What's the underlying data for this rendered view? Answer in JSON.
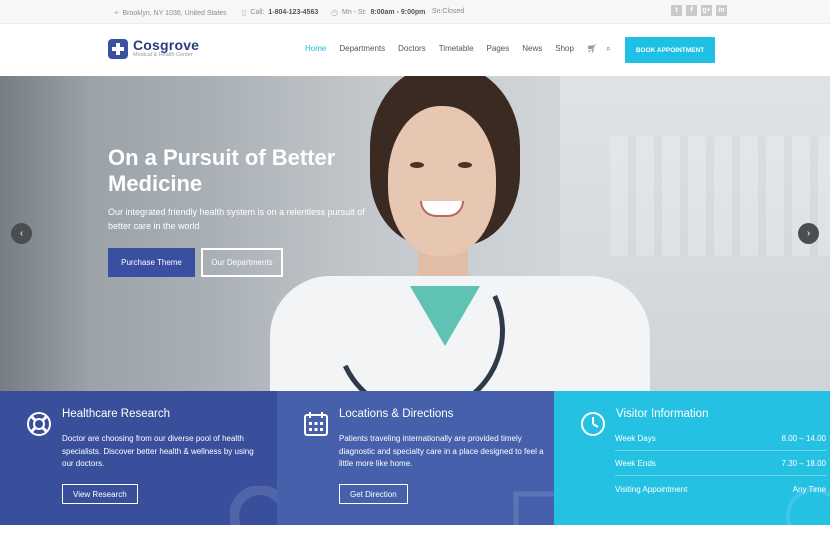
{
  "topbar": {
    "address": "Brooklyn, NY 1036, United States",
    "call_label": "Call:",
    "call_number": "1-804-123-4563",
    "hours_label": "Mn - St:",
    "hours": "8:00am - 9:00pm",
    "sunday": "Sn:Closed",
    "social": [
      "twitter-icon",
      "facebook-icon",
      "google-plus-icon",
      "linkedin-icon"
    ]
  },
  "header": {
    "logo_name": "Cosgrove",
    "logo_tagline": "Medical & Health Center",
    "nav": [
      "Home",
      "Departments",
      "Doctors",
      "Timetable",
      "Pages",
      "News",
      "Shop"
    ],
    "book_button": "BOOK APPOINTMENT"
  },
  "hero": {
    "title": "On a Pursuit of Better Medicine",
    "subtitle": "Our integrated friendly health system is on a relentless pursuit of better care in the world",
    "primary_button": "Purchase Theme",
    "secondary_button": "Our Departments"
  },
  "panels": {
    "research": {
      "title": "Healthcare Research",
      "text": "Doctor are choosing from our diverse pool of health specialists. Discover better health & wellness by using our doctors.",
      "button": "View Research"
    },
    "locations": {
      "title": "Locations & Directions",
      "text": "Patients traveling internationally are provided timely diagnostic and specialty care in a place designed to feel a little more like home.",
      "button": "Get Direction"
    },
    "visitor": {
      "title": "Visitor Information",
      "rows": [
        {
          "label": "Week Days",
          "value": "8.00 – 14.00"
        },
        {
          "label": "Week Ends",
          "value": "7.30 – 18.00"
        },
        {
          "label": "Visiting Appointment",
          "value": "Any Time"
        }
      ]
    }
  },
  "colors": {
    "brand": "#3a4fa0",
    "accent": "#1ec0e4",
    "panel_research": "#3a4f9c",
    "panel_locations": "#4660ac",
    "panel_visitor": "#24c1e3"
  }
}
